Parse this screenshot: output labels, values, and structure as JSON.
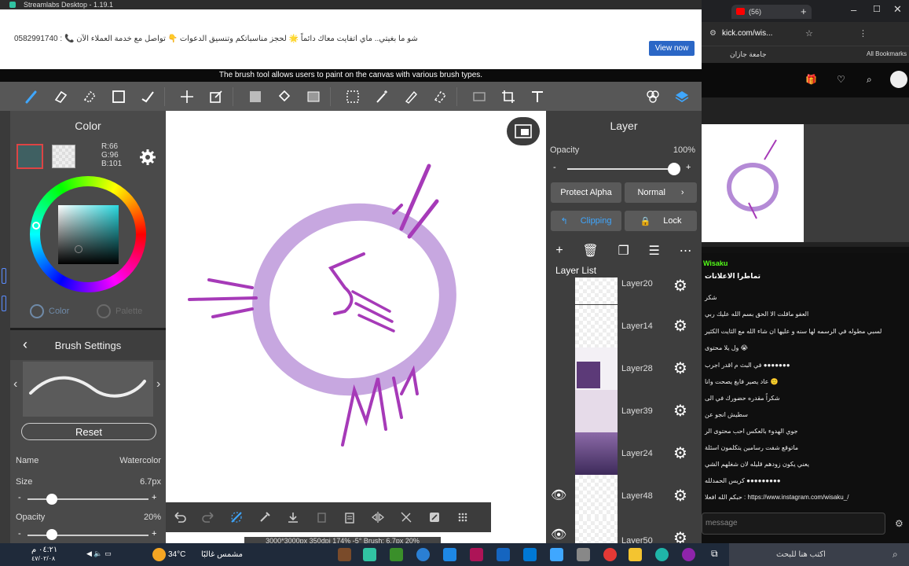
{
  "titlebar": {
    "app_title": "Streamlabs Desktop - 1.19.1"
  },
  "ad": {
    "text": "شو ما بغيتي.. ماي اتفايت معاك دائماً 🌟 لحجز مناسباتكم وتنسيق الدعوات 👇 تواصل مع خدمة العملاء الآن 📞 : 0582991740",
    "button": "View now"
  },
  "tooltip": "The brush tool allows users to paint on the canvas with various brush types.",
  "toolbar": {
    "left_tools": [
      "brush-icon",
      "eraser-icon",
      "blur-eraser-icon",
      "shape-icon",
      "lasso-select-icon",
      "move-icon",
      "transform-icon",
      "fill-color-icon",
      "bucket-icon",
      "gradient-icon",
      "selection-icon",
      "magic-wand-icon",
      "select-pen-icon",
      "select-eraser-icon",
      "deselect-icon",
      "crop-icon",
      "text-icon"
    ],
    "right_tools": [
      "materials-icon",
      "layers-icon"
    ],
    "accent": "#3fa7ff"
  },
  "color_panel": {
    "title": "Color",
    "r": "R:66",
    "g": "G:96",
    "b": "B:101",
    "current_color": "#3f6062",
    "tab_color": "Color",
    "tab_palette": "Palette"
  },
  "brush_settings": {
    "title": "Brush Settings",
    "reset": "Reset",
    "name_label": "Name",
    "name_value": "Watercolor",
    "size_label": "Size",
    "size_value": "6.7px",
    "size_fraction": 0.2,
    "opacity_label": "Opacity",
    "opacity_value": "20%",
    "opacity_fraction": 0.2
  },
  "canvas": {
    "status": "3000*3000px 350dpi 174% -5° Brush: 6.7px 20%",
    "stroke_color": "#b48ad6",
    "ink_color": "#a63ab8"
  },
  "layer_panel": {
    "title": "Layer",
    "opacity_label": "Opacity",
    "opacity_value": "100%",
    "opacity_fraction": 1.0,
    "protect_alpha": "Protect Alpha",
    "blend_mode": "Normal",
    "clipping": "Clipping",
    "lock": "Lock",
    "list_title": "Layer List",
    "layers": [
      {
        "name": "Layer20"
      },
      {
        "name": "Layer14"
      },
      {
        "name": "Layer28"
      },
      {
        "name": "Layer39"
      },
      {
        "name": "Layer24"
      },
      {
        "name": "Layer48"
      },
      {
        "name": "Layer50"
      }
    ]
  },
  "browser": {
    "tab_title": "(56)",
    "url": "kick.com/wis...",
    "bookmark1": "جامعة جازان",
    "all_bookmarks": "All Bookmarks",
    "channel": "Wisaku",
    "pinned": "تماطرا الاعلانات",
    "chat": [
      "شكر",
      "العفو ماقلت الا الحق بسم الله عليك ربي",
      "لسبي مطوله في الرسمه لها سنه و عليها ان شاء الله مع الثايت الكثير",
      "ول يلا محتوى 😭",
      "في البث م اقدر اجرب ●●●●●●●",
      "عاد يصير فايغ يصحت وانا 🙂",
      "شكراً مقدره حضورك في الى",
      "سطيش انجو عن",
      "جوي الهدوء بالعكس احب محتوى الر",
      "ماتوقع شفت رسامين يتكلمون اسئلة",
      "يعني يكون زودهم قليله لان شغلهم الشي",
      "كريس الحمدلله ●●●●●●●●●",
      "حبكم الله افعلا : https://www.instagram.com/wisaku_/"
    ],
    "message_placeholder": "message"
  },
  "taskbar": {
    "time": "٠٤:٢١ م",
    "date": "٤٧/٠٢/٠٨",
    "temperature": "34°C",
    "weather": "مشمس غالبًا",
    "search": "اكتب هنا للبحث"
  }
}
